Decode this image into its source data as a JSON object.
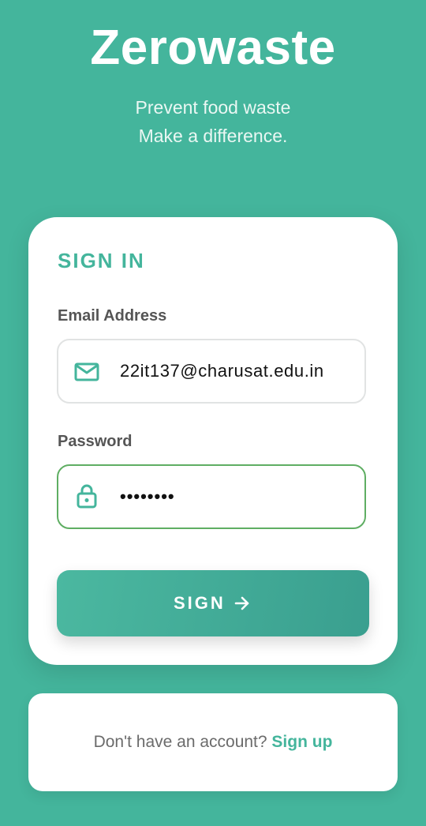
{
  "header": {
    "title": "Zerowaste",
    "tagline_line1": "Prevent food waste",
    "tagline_line2": "Make a difference."
  },
  "signin": {
    "heading": "SIGN IN",
    "email_label": "Email Address",
    "email_value": "22it137@charusat.edu.in",
    "password_label": "Password",
    "password_value": "••••••••",
    "button_label": "SIGN"
  },
  "footer": {
    "prompt": "Don't have an account?",
    "link": "Sign up"
  },
  "colors": {
    "background": "#44b59c",
    "accent": "#44b59c",
    "focus_border": "#5fae63"
  },
  "icons": [
    "mail-icon",
    "lock-icon",
    "arrow-right-icon"
  ]
}
